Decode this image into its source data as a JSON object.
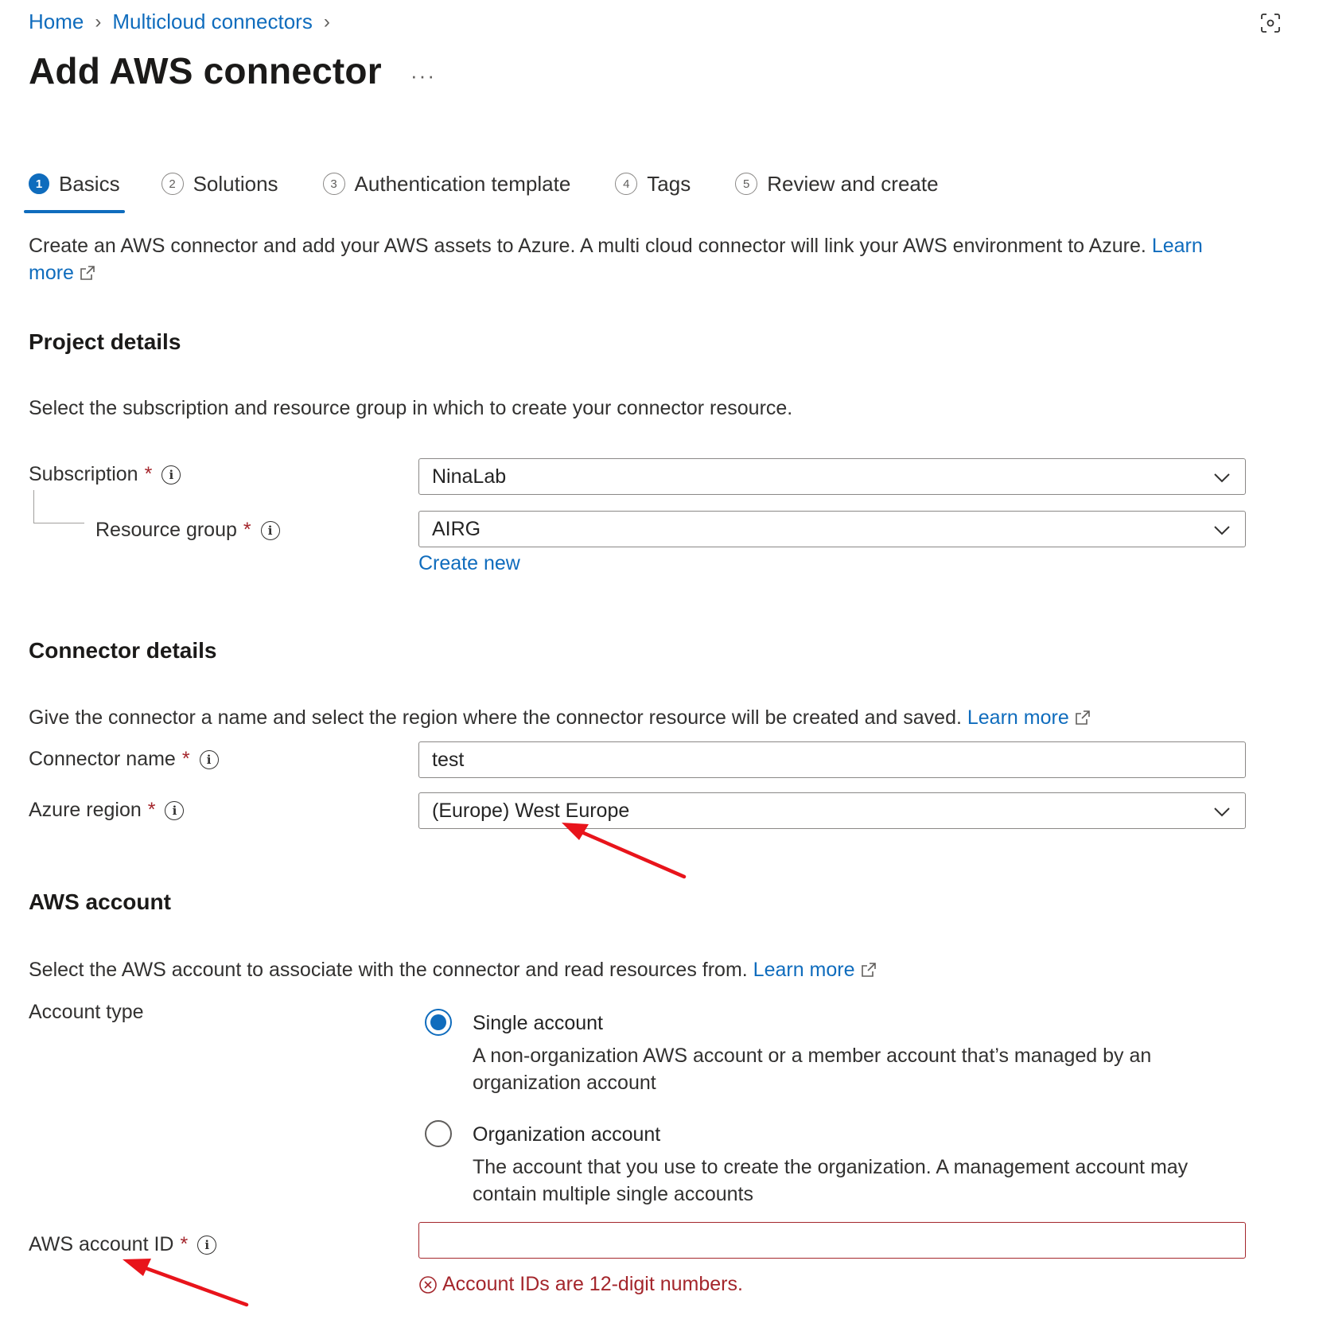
{
  "breadcrumb": {
    "items": [
      "Home",
      "Multicloud connectors"
    ]
  },
  "page": {
    "title": "Add AWS connector",
    "more": "···"
  },
  "tabs": [
    {
      "num": "1",
      "label": "Basics"
    },
    {
      "num": "2",
      "label": "Solutions"
    },
    {
      "num": "3",
      "label": "Authentication template"
    },
    {
      "num": "4",
      "label": "Tags"
    },
    {
      "num": "5",
      "label": "Review and create"
    }
  ],
  "intro": {
    "text": "Create an AWS connector and add your AWS assets to Azure. A multi cloud connector will link your AWS environment to Azure.",
    "link1": "Learn",
    "link2": "more"
  },
  "project": {
    "heading": "Project details",
    "desc": "Select the subscription and resource group in which to create your connector resource.",
    "subscription_label": "Subscription",
    "subscription_value": "NinaLab",
    "rg_label": "Resource group",
    "rg_value": "AIRG",
    "create_new": "Create new"
  },
  "connector": {
    "heading": "Connector details",
    "desc": "Give the connector a name and select the region where the connector resource will be created and saved.",
    "learn_more": "Learn more",
    "name_label": "Connector name",
    "name_value": "test",
    "region_label": "Azure region",
    "region_value": "(Europe) West Europe"
  },
  "aws": {
    "heading": "AWS account",
    "desc": "Select the AWS account to associate with the connector and read resources from.",
    "learn_more": "Learn more",
    "type_label": "Account type",
    "options": [
      {
        "title": "Single account",
        "desc1": "A non-organization AWS account or a member account that’s managed by an",
        "desc2": "organization account",
        "checked": true
      },
      {
        "title": "Organization account",
        "desc1": "The account that you use to create the organization. A management account may",
        "desc2": "contain multiple single accounts",
        "checked": false
      }
    ],
    "id_label": "AWS account ID",
    "id_value": "",
    "error": "Account IDs are 12-digit numbers."
  },
  "common": {
    "required": "*",
    "info": "i"
  },
  "colors": {
    "accent": "#0f6cbd",
    "error": "#a4262c",
    "annotation": "#e8141b"
  }
}
